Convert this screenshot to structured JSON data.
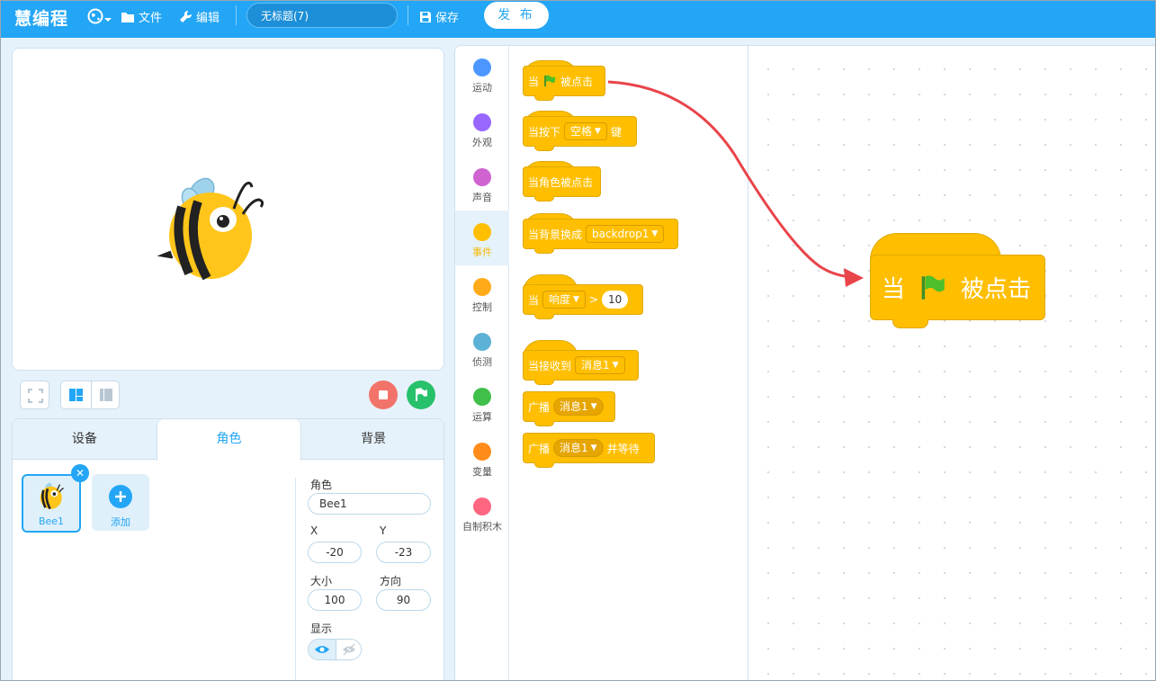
{
  "app": {
    "logo": "慧编程",
    "project_title": "无标题(7)"
  },
  "menu": {
    "file": "文件",
    "edit": "编辑",
    "save": "保存",
    "publish": "发 布"
  },
  "tabs": [
    "设备",
    "角色",
    "背景"
  ],
  "sprite": {
    "name": "Bee1",
    "add_label": "添加",
    "props": {
      "sprite_label": "角色",
      "sprite_value": "Bee1",
      "x_label": "X",
      "x_value": "-20",
      "y_label": "Y",
      "y_value": "-23",
      "size_label": "大小",
      "size_value": "100",
      "dir_label": "方向",
      "dir_value": "90",
      "show_label": "显示"
    }
  },
  "categories": [
    {
      "label": "运动",
      "color": "#4c97ff"
    },
    {
      "label": "外观",
      "color": "#9966ff"
    },
    {
      "label": "声音",
      "color": "#cf63cf"
    },
    {
      "label": "事件",
      "color": "#ffbf00"
    },
    {
      "label": "控制",
      "color": "#ffab19"
    },
    {
      "label": "侦测",
      "color": "#5cb1d6"
    },
    {
      "label": "运算",
      "color": "#40bf4a"
    },
    {
      "label": "变量",
      "color": "#ff8c1a"
    },
    {
      "label": "自制积木",
      "color": "#ff6680"
    }
  ],
  "blocks": {
    "flag_clicked": {
      "pre": "当",
      "post": "被点击"
    },
    "key_pressed": {
      "pre": "当按下",
      "key": "空格",
      "post": "键"
    },
    "sprite_clicked": {
      "text": "当角色被点击"
    },
    "backdrop_switch": {
      "pre": "当背景换成",
      "value": "backdrop1"
    },
    "loudness": {
      "pre": "当",
      "value": "响度",
      "op": ">",
      "num": "10"
    },
    "receive": {
      "pre": "当接收到",
      "value": "消息1"
    },
    "broadcast": {
      "pre": "广播",
      "value": "消息1"
    },
    "broadcast_wait": {
      "pre": "广播",
      "value": "消息1",
      "post": "并等待"
    }
  },
  "workspace_block": {
    "pre": "当",
    "post": "被点击"
  },
  "colors": {
    "accent": "#23a6f5",
    "events": "#ffbf00",
    "stop": "#f2736a",
    "go": "#27c16c",
    "arrow": "#e8444a"
  }
}
